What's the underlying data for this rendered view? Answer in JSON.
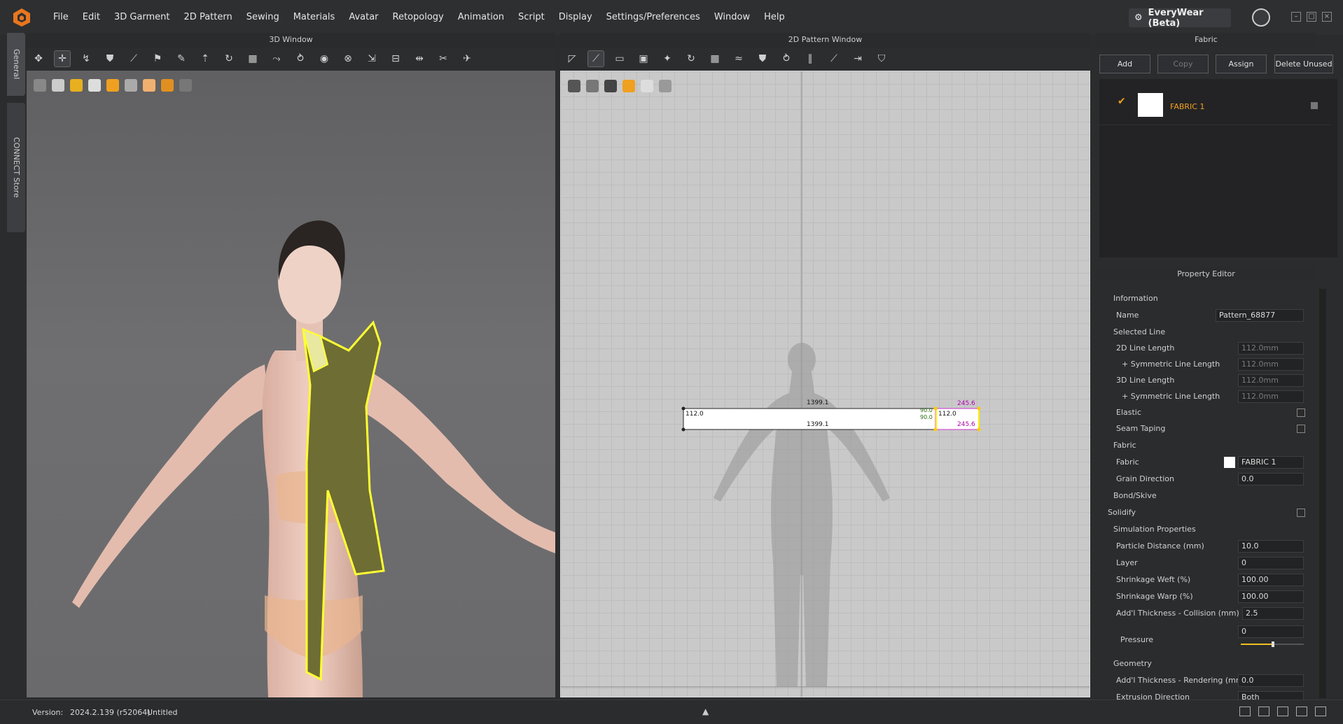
{
  "menubar": {
    "items": [
      "File",
      "Edit",
      "3D Garment",
      "2D Pattern",
      "Sewing",
      "Materials",
      "Avatar",
      "Retopology",
      "Animation",
      "Script",
      "Display",
      "Settings/Preferences",
      "Window",
      "Help"
    ],
    "everywear": "EveryWear (Beta)"
  },
  "sidetabs": {
    "general": "General",
    "connect": "CONNECT Store"
  },
  "window3d": {
    "title": "3D Window"
  },
  "window2d": {
    "title": "2D Pattern Window",
    "measure_top": "1399.1",
    "measure_bottom": "1399.1",
    "measure_left": "112.0",
    "measure_right": "112.0",
    "measure_angle_top": "90.0",
    "measure_angle_bottom": "90.0",
    "measure_small_top": "245.6",
    "measure_small_bottom": "245.6"
  },
  "fabric_panel": {
    "title": "Fabric",
    "buttons": {
      "add": "Add",
      "copy": "Copy",
      "assign": "Assign",
      "delete_unused": "Delete Unused"
    },
    "items": [
      {
        "name": "FABRIC 1",
        "checked": true,
        "swatch": "#ffffff"
      }
    ]
  },
  "property_editor": {
    "title": "Property Editor",
    "information": "Information",
    "name_label": "Name",
    "name_value": "Pattern_68877",
    "selected_line": "Selected Line",
    "line2d_label": "2D Line Length",
    "line2d_value": "112.0mm",
    "sym1_label": "+ Symmetric Line Length",
    "sym1_value": "112.0mm",
    "line3d_label": "3D Line Length",
    "line3d_value": "112.0mm",
    "sym2_label": "+ Symmetric Line Length",
    "sym2_value": "112.0mm",
    "elastic_label": "Elastic",
    "seam_label": "Seam Taping",
    "fabric_section": "Fabric",
    "fabric_label": "Fabric",
    "fabric_value": "FABRIC 1",
    "grain_label": "Grain Direction",
    "grain_value": "0.0",
    "bond": "Bond/Skive",
    "solidify": "Solidify",
    "sim": "Simulation Properties",
    "particle_label": "Particle Distance (mm)",
    "particle_value": "10.0",
    "layer_label": "Layer",
    "layer_value": "0",
    "weft_label": "Shrinkage Weft (%)",
    "weft_value": "100.00",
    "warp_label": "Shrinkage Warp (%)",
    "warp_value": "100.00",
    "collision_label": "Add'l Thickness - Collision (mm)",
    "collision_value": "2.5",
    "pressure_label": "Pressure",
    "pressure_value": "0",
    "geometry": "Geometry",
    "render_label": "Add'l Thickness - Rendering (mm)",
    "render_value": "0.0",
    "extrusion_label": "Extrusion Direction",
    "extrusion_value": "Both"
  },
  "statusbar": {
    "version_label": "Version:",
    "version": "2024.2.139 (r52064)",
    "file": "Untitled"
  },
  "colors": {
    "accent": "#f0a020",
    "selection": "#ffff33",
    "scarf": "#7a7a3a"
  }
}
